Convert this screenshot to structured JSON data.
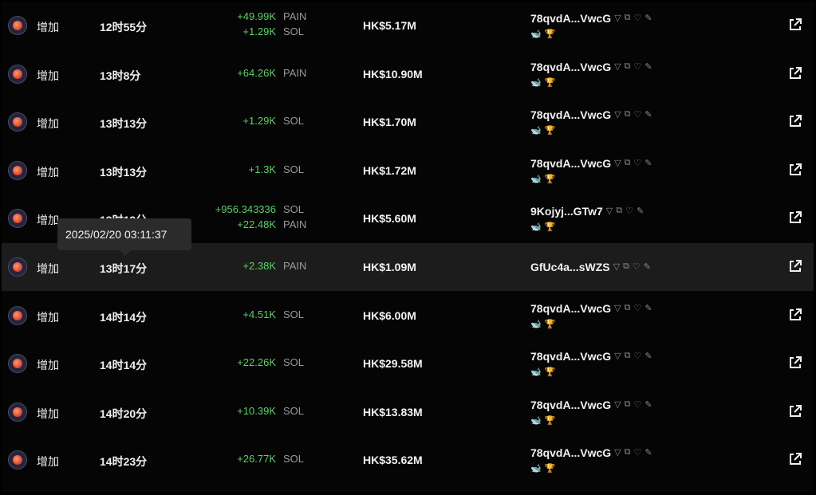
{
  "tooltip": {
    "text": "2025/02/20 03:11:37"
  },
  "rows": [
    {
      "type": "增加",
      "age": "12时55分",
      "amounts": [
        {
          "value": "+49.99K",
          "symbol": "PAIN"
        },
        {
          "value": "+1.29K",
          "symbol": "SOL"
        }
      ],
      "value": "HK$5.17M",
      "maker": "78qvdA...VwcG",
      "tags": [
        "🐋",
        "🏆"
      ]
    },
    {
      "type": "增加",
      "age": "13时8分",
      "amounts": [
        {
          "value": "+64.26K",
          "symbol": "PAIN"
        }
      ],
      "value": "HK$10.90M",
      "maker": "78qvdA...VwcG",
      "tags": [
        "🐋",
        "🏆"
      ]
    },
    {
      "type": "增加",
      "age": "13时13分",
      "amounts": [
        {
          "value": "+1.29K",
          "symbol": "SOL"
        }
      ],
      "value": "HK$1.70M",
      "maker": "78qvdA...VwcG",
      "tags": [
        "🐋",
        "🏆"
      ]
    },
    {
      "type": "增加",
      "age": "13时13分",
      "amounts": [
        {
          "value": "+1.3K",
          "symbol": "SOL"
        }
      ],
      "value": "HK$1.72M",
      "maker": "78qvdA...VwcG",
      "tags": [
        "🐋",
        "🏆"
      ]
    },
    {
      "type": "增加",
      "age": "13时13分",
      "amounts": [
        {
          "value": "+956.343336",
          "symbol": "SOL"
        },
        {
          "value": "+22.48K",
          "symbol": "PAIN"
        }
      ],
      "value": "HK$5.60M",
      "maker": "9Kojyj...GTw7",
      "tags": [
        "🐋",
        "🏆"
      ]
    },
    {
      "type": "增加",
      "age": "13时17分",
      "amounts": [
        {
          "value": "+2.38K",
          "symbol": "PAIN"
        }
      ],
      "value": "HK$1.09M",
      "maker": "GfUc4a...sWZS",
      "tags": []
    },
    {
      "type": "增加",
      "age": "14时14分",
      "amounts": [
        {
          "value": "+4.51K",
          "symbol": "SOL"
        }
      ],
      "value": "HK$6.00M",
      "maker": "78qvdA...VwcG",
      "tags": [
        "🐋",
        "🏆"
      ]
    },
    {
      "type": "增加",
      "age": "14时14分",
      "amounts": [
        {
          "value": "+22.26K",
          "symbol": "SOL"
        }
      ],
      "value": "HK$29.58M",
      "maker": "78qvdA...VwcG",
      "tags": [
        "🐋",
        "🏆"
      ]
    },
    {
      "type": "增加",
      "age": "14时20分",
      "amounts": [
        {
          "value": "+10.39K",
          "symbol": "SOL"
        }
      ],
      "value": "HK$13.83M",
      "maker": "78qvdA...VwcG",
      "tags": [
        "🐋",
        "🏆"
      ]
    },
    {
      "type": "增加",
      "age": "14时23分",
      "amounts": [
        {
          "value": "+26.77K",
          "symbol": "SOL"
        }
      ],
      "value": "HK$35.62M",
      "maker": "78qvdA...VwcG",
      "tags": [
        "🐋",
        "🏆"
      ]
    }
  ],
  "icons": {
    "token": "token-logo-icon",
    "filter": "filter-icon",
    "copy": "copy-icon",
    "favorite": "heart-icon",
    "edit": "pencil-icon",
    "external": "external-link-icon"
  },
  "colors": {
    "positive": "#5fcf6a",
    "background": "#050505",
    "hover_row": "#1c1c1c"
  }
}
